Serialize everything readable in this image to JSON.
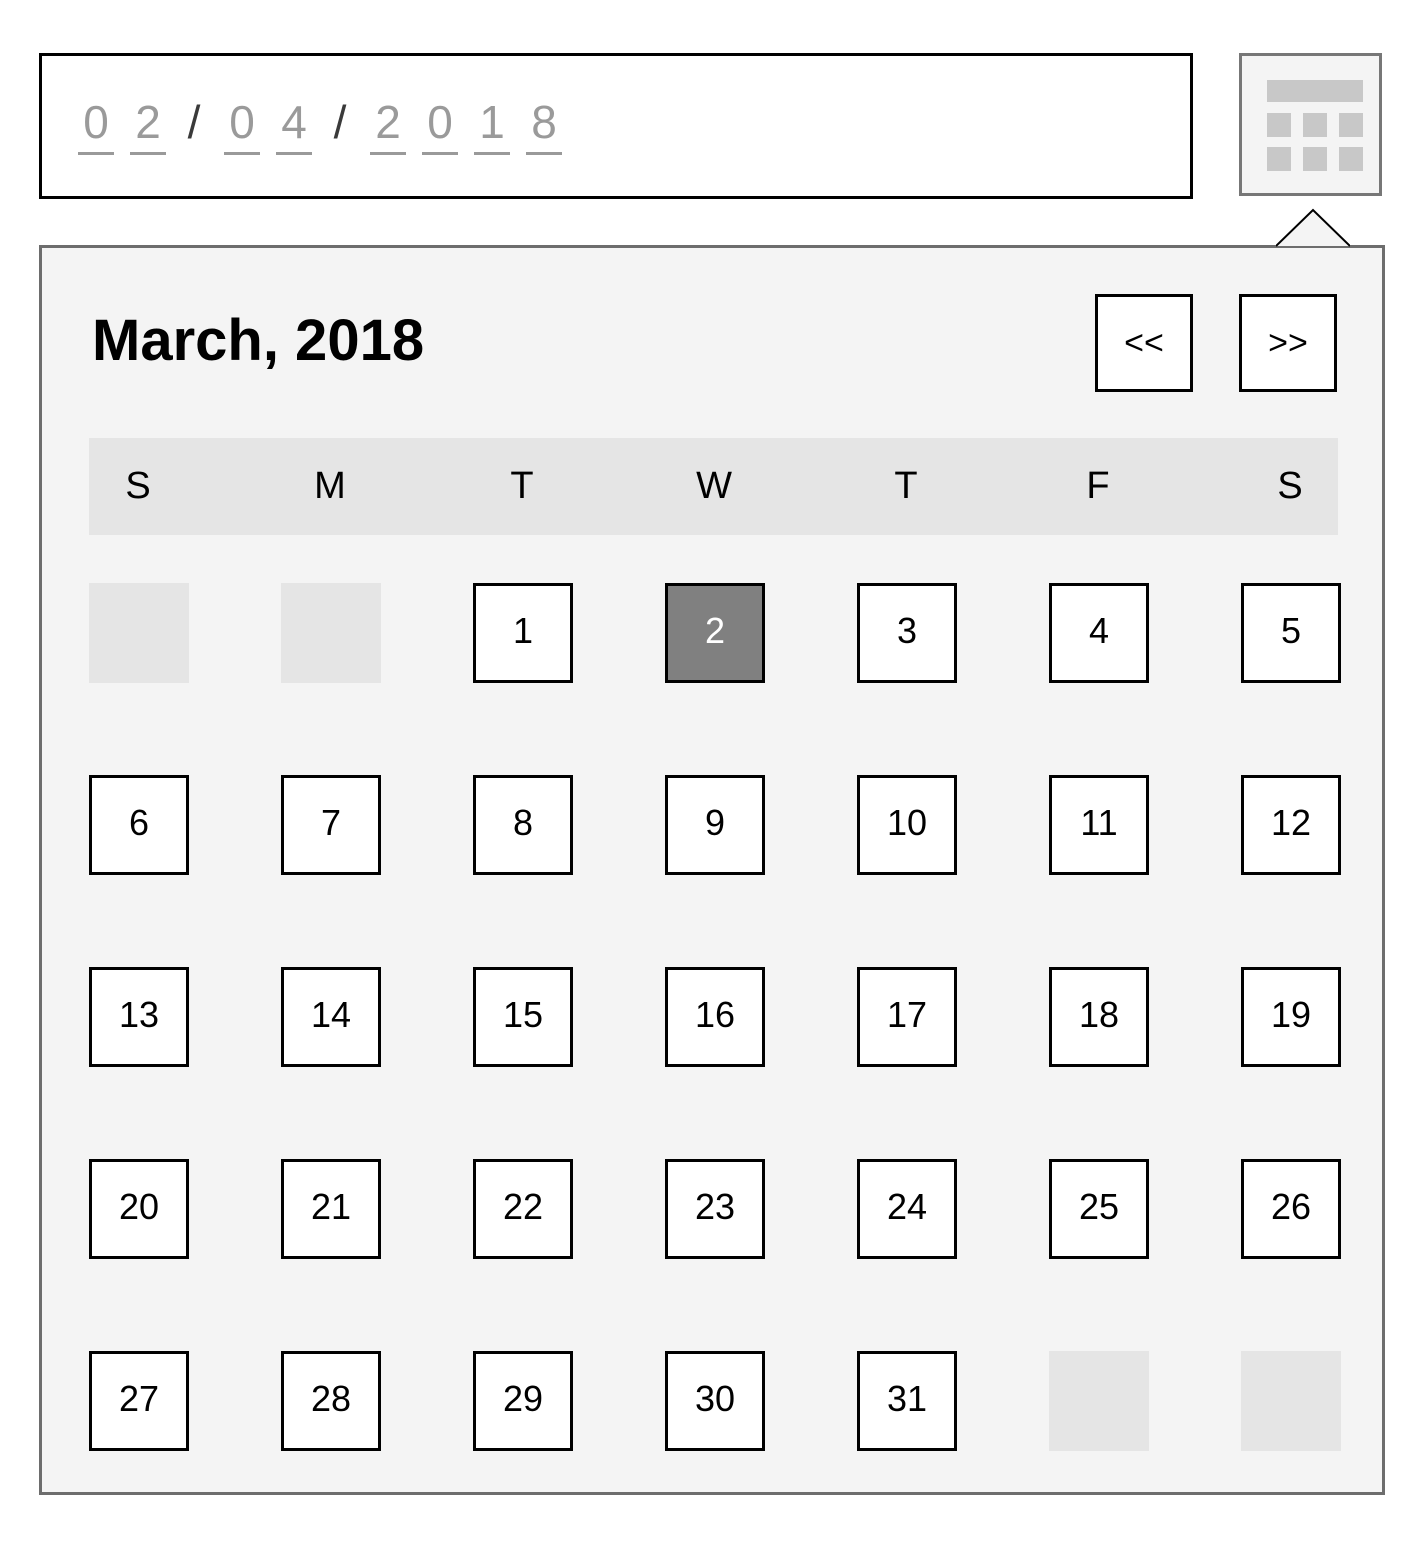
{
  "date_input": {
    "month_digits": [
      "0",
      "2"
    ],
    "day_digits": [
      "0",
      "4"
    ],
    "year_digits": [
      "2",
      "0",
      "1",
      "8"
    ],
    "separator": "/"
  },
  "calendar_button": {
    "icon": "calendar-icon"
  },
  "calendar": {
    "title": "March, 2018",
    "prev_label": "<<",
    "next_label": ">>",
    "weekdays": [
      "S",
      "M",
      "T",
      "W",
      "T",
      "F",
      "S"
    ],
    "weeks": [
      [
        "",
        "",
        "1",
        "2",
        "3",
        "4",
        "5"
      ],
      [
        "6",
        "7",
        "8",
        "9",
        "10",
        "11",
        "12"
      ],
      [
        "13",
        "14",
        "15",
        "16",
        "17",
        "18",
        "19"
      ],
      [
        "20",
        "21",
        "22",
        "23",
        "24",
        "25",
        "26"
      ],
      [
        "27",
        "28",
        "29",
        "30",
        "31",
        "",
        ""
      ]
    ],
    "selected_day": "2"
  },
  "colors": {
    "selected_fill": "#808080",
    "popup_background": "#f4f4f4",
    "weekday_bar": "#e5e5e5",
    "placeholder_digit": "#9a9a9a"
  }
}
